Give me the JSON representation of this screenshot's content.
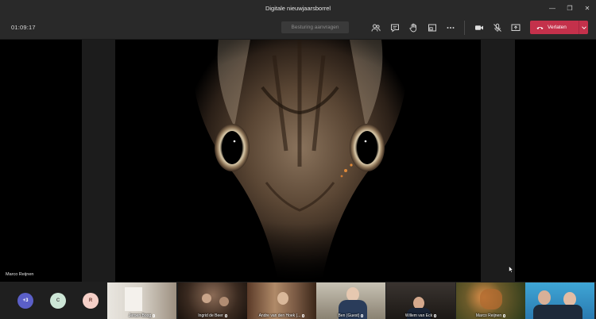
{
  "window": {
    "title": "Digitale nieuwjaarsborrel",
    "minimize_glyph": "—",
    "maximize_glyph": "❐",
    "close_glyph": "✕"
  },
  "toolbar": {
    "timer": "01:09:17",
    "request_control_label": "Besturing aanvragen",
    "leave_label": "Verlaten",
    "icons": [
      "participants-icon",
      "chat-icon",
      "raise-hand-icon",
      "breakout-rooms-icon",
      "more-actions-icon",
      "camera-icon",
      "mic-muted-icon",
      "share-screen-icon"
    ]
  },
  "main": {
    "speaker_name": "Marco Reijnen"
  },
  "gallery": {
    "avatars": [
      {
        "label": "+3",
        "bg": "#5b5fc7",
        "fg": "#ffffff"
      },
      {
        "label": "C",
        "bg": "#cde6d6",
        "fg": "#4f4f4f"
      },
      {
        "label": "R",
        "bg": "#f5d0c8",
        "fg": "#6b3a30"
      }
    ],
    "tiles": [
      {
        "name": "Jeroen Boog"
      },
      {
        "name": "Ingrid de Beer"
      },
      {
        "name": "Andre van den Hoek (..."
      },
      {
        "name": "Ben (Guest)"
      },
      {
        "name": "Willem van Eck"
      },
      {
        "name": "Marco Reijnen"
      },
      {
        "name": ""
      }
    ]
  },
  "colors": {
    "leave_button": "#c4314b",
    "chrome": "#292929",
    "stage": "#000000"
  }
}
